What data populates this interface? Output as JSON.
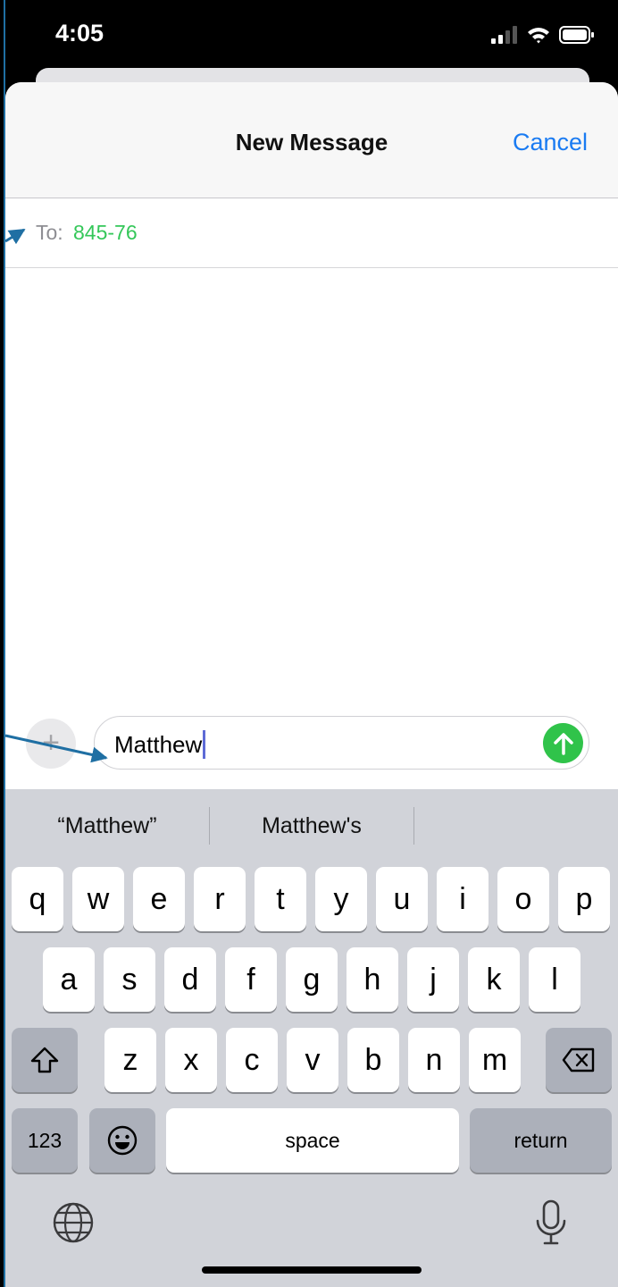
{
  "status_bar": {
    "time": "4:05",
    "icons": [
      "cellular-signal-icon",
      "wifi-icon",
      "battery-icon"
    ]
  },
  "header": {
    "title": "New Message",
    "cancel_label": "Cancel"
  },
  "recipient": {
    "label": "To:",
    "value": "845-76"
  },
  "compose": {
    "text": "Matthew",
    "add_icon": "plus-icon",
    "send_icon": "send-arrow-icon"
  },
  "suggestions": [
    "“Matthew”",
    "Matthew's",
    ""
  ],
  "keyboard": {
    "row1": [
      "q",
      "w",
      "e",
      "r",
      "t",
      "y",
      "u",
      "i",
      "o",
      "p"
    ],
    "row2": [
      "a",
      "s",
      "d",
      "f",
      "g",
      "h",
      "j",
      "k",
      "l"
    ],
    "row3": [
      "z",
      "x",
      "c",
      "v",
      "b",
      "n",
      "m"
    ],
    "numbers_label": "123",
    "space_label": "space",
    "return_label": "return",
    "icons": [
      "shift-icon",
      "backspace-icon",
      "emoji-icon",
      "globe-icon",
      "microphone-icon"
    ]
  },
  "colors": {
    "accent": "#1a7bf2",
    "recipient": "#34c759",
    "send": "#30c34a",
    "keyboard_bg": "#d1d3d9",
    "annotation": "#1f6fa3"
  }
}
